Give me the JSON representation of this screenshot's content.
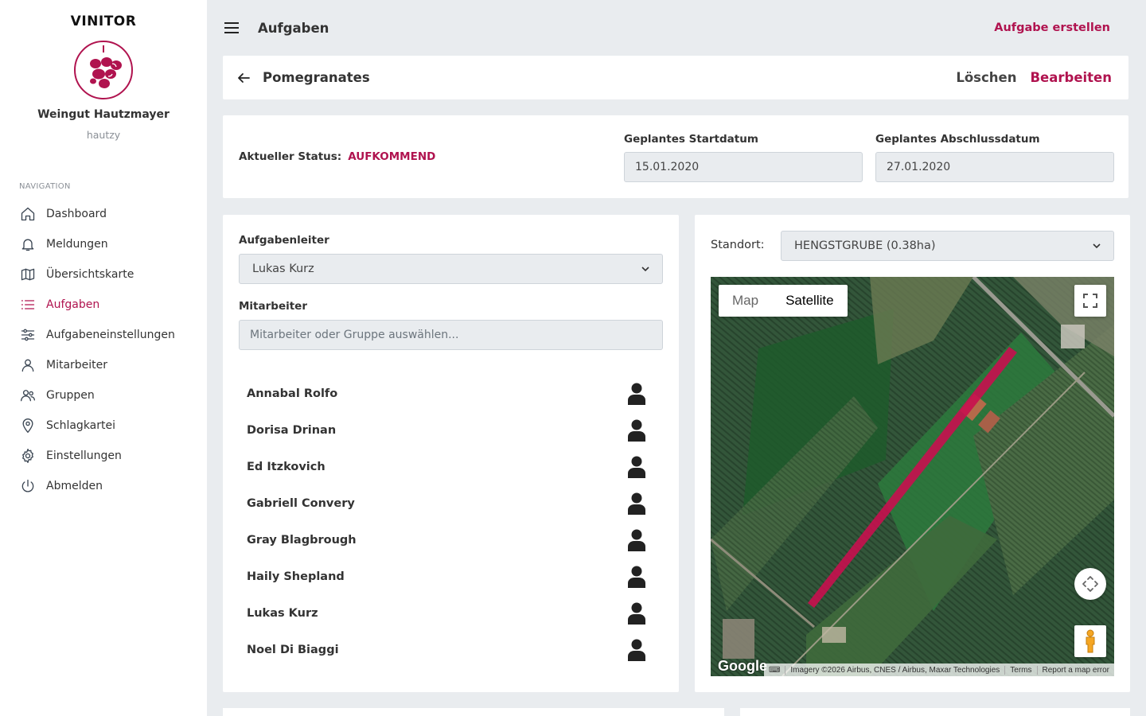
{
  "sidebar": {
    "brand": "VINITOR",
    "company": "Weingut Hautzmayer",
    "username": "hautzy",
    "nav_title": "NAVIGATION",
    "items": [
      {
        "label": "Dashboard",
        "icon": "home-icon"
      },
      {
        "label": "Meldungen",
        "icon": "bell-icon"
      },
      {
        "label": "Übersichtskarte",
        "icon": "map-icon"
      },
      {
        "label": "Aufgaben",
        "icon": "list-icon",
        "active": true
      },
      {
        "label": "Aufgabeneinstellungen",
        "icon": "sliders-icon"
      },
      {
        "label": "Mitarbeiter",
        "icon": "user-icon"
      },
      {
        "label": "Gruppen",
        "icon": "users-icon"
      },
      {
        "label": "Schlagkartei",
        "icon": "location-pin-icon"
      },
      {
        "label": "Einstellungen",
        "icon": "gear-icon"
      },
      {
        "label": "Abmelden",
        "icon": "power-icon"
      }
    ]
  },
  "header": {
    "title": "Aufgaben",
    "create_label": "Aufgabe erstellen"
  },
  "task": {
    "name": "Pomegranates",
    "delete_label": "Löschen",
    "edit_label": "Bearbeiten"
  },
  "status": {
    "label": "Aktueller Status:",
    "value": "AUFKOMMEND",
    "start_label": "Geplantes Startdatum",
    "start_value": "15.01.2020",
    "end_label": "Geplantes Abschlussdatum",
    "end_value": "27.01.2020"
  },
  "staff": {
    "leader_label": "Aufgabenleiter",
    "leader_value": "Lukas Kurz",
    "workers_label": "Mitarbeiter",
    "workers_placeholder": "Mitarbeiter oder Gruppe auswählen...",
    "members": [
      "Annabal Rolfo",
      "Dorisa Drinan",
      "Ed Itzkovich",
      "Gabriell Convery",
      "Gray Blagbrough",
      "Haily Shepland",
      "Lukas Kurz",
      "Noel Di Biaggi"
    ]
  },
  "map": {
    "location_label": "Standort:",
    "location_value": "HENGSTGRUBE (0.38ha)",
    "toggle_map": "Map",
    "toggle_satellite": "Satellite",
    "google": "Google",
    "attribution": "Imagery ©2026 Airbus, CNES / Airbus, Maxar Technologies",
    "terms": "Terms",
    "report": "Report a map error",
    "field_color": "#c8104f"
  },
  "colors": {
    "accent": "#b0134f",
    "background": "#e9ecef"
  }
}
